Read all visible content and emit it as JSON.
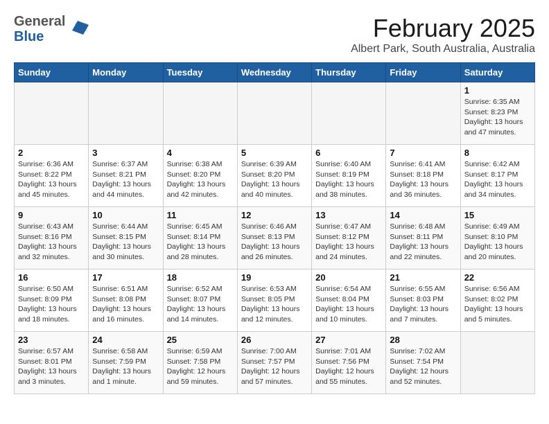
{
  "header": {
    "logo_general": "General",
    "logo_blue": "Blue",
    "month_title": "February 2025",
    "subtitle": "Albert Park, South Australia, Australia"
  },
  "days_of_week": [
    "Sunday",
    "Monday",
    "Tuesday",
    "Wednesday",
    "Thursday",
    "Friday",
    "Saturday"
  ],
  "weeks": [
    [
      {
        "day": "",
        "info": ""
      },
      {
        "day": "",
        "info": ""
      },
      {
        "day": "",
        "info": ""
      },
      {
        "day": "",
        "info": ""
      },
      {
        "day": "",
        "info": ""
      },
      {
        "day": "",
        "info": ""
      },
      {
        "day": "1",
        "info": "Sunrise: 6:35 AM\nSunset: 8:23 PM\nDaylight: 13 hours and 47 minutes."
      }
    ],
    [
      {
        "day": "2",
        "info": "Sunrise: 6:36 AM\nSunset: 8:22 PM\nDaylight: 13 hours and 45 minutes."
      },
      {
        "day": "3",
        "info": "Sunrise: 6:37 AM\nSunset: 8:21 PM\nDaylight: 13 hours and 44 minutes."
      },
      {
        "day": "4",
        "info": "Sunrise: 6:38 AM\nSunset: 8:20 PM\nDaylight: 13 hours and 42 minutes."
      },
      {
        "day": "5",
        "info": "Sunrise: 6:39 AM\nSunset: 8:20 PM\nDaylight: 13 hours and 40 minutes."
      },
      {
        "day": "6",
        "info": "Sunrise: 6:40 AM\nSunset: 8:19 PM\nDaylight: 13 hours and 38 minutes."
      },
      {
        "day": "7",
        "info": "Sunrise: 6:41 AM\nSunset: 8:18 PM\nDaylight: 13 hours and 36 minutes."
      },
      {
        "day": "8",
        "info": "Sunrise: 6:42 AM\nSunset: 8:17 PM\nDaylight: 13 hours and 34 minutes."
      }
    ],
    [
      {
        "day": "9",
        "info": "Sunrise: 6:43 AM\nSunset: 8:16 PM\nDaylight: 13 hours and 32 minutes."
      },
      {
        "day": "10",
        "info": "Sunrise: 6:44 AM\nSunset: 8:15 PM\nDaylight: 13 hours and 30 minutes."
      },
      {
        "day": "11",
        "info": "Sunrise: 6:45 AM\nSunset: 8:14 PM\nDaylight: 13 hours and 28 minutes."
      },
      {
        "day": "12",
        "info": "Sunrise: 6:46 AM\nSunset: 8:13 PM\nDaylight: 13 hours and 26 minutes."
      },
      {
        "day": "13",
        "info": "Sunrise: 6:47 AM\nSunset: 8:12 PM\nDaylight: 13 hours and 24 minutes."
      },
      {
        "day": "14",
        "info": "Sunrise: 6:48 AM\nSunset: 8:11 PM\nDaylight: 13 hours and 22 minutes."
      },
      {
        "day": "15",
        "info": "Sunrise: 6:49 AM\nSunset: 8:10 PM\nDaylight: 13 hours and 20 minutes."
      }
    ],
    [
      {
        "day": "16",
        "info": "Sunrise: 6:50 AM\nSunset: 8:09 PM\nDaylight: 13 hours and 18 minutes."
      },
      {
        "day": "17",
        "info": "Sunrise: 6:51 AM\nSunset: 8:08 PM\nDaylight: 13 hours and 16 minutes."
      },
      {
        "day": "18",
        "info": "Sunrise: 6:52 AM\nSunset: 8:07 PM\nDaylight: 13 hours and 14 minutes."
      },
      {
        "day": "19",
        "info": "Sunrise: 6:53 AM\nSunset: 8:05 PM\nDaylight: 13 hours and 12 minutes."
      },
      {
        "day": "20",
        "info": "Sunrise: 6:54 AM\nSunset: 8:04 PM\nDaylight: 13 hours and 10 minutes."
      },
      {
        "day": "21",
        "info": "Sunrise: 6:55 AM\nSunset: 8:03 PM\nDaylight: 13 hours and 7 minutes."
      },
      {
        "day": "22",
        "info": "Sunrise: 6:56 AM\nSunset: 8:02 PM\nDaylight: 13 hours and 5 minutes."
      }
    ],
    [
      {
        "day": "23",
        "info": "Sunrise: 6:57 AM\nSunset: 8:01 PM\nDaylight: 13 hours and 3 minutes."
      },
      {
        "day": "24",
        "info": "Sunrise: 6:58 AM\nSunset: 7:59 PM\nDaylight: 13 hours and 1 minute."
      },
      {
        "day": "25",
        "info": "Sunrise: 6:59 AM\nSunset: 7:58 PM\nDaylight: 12 hours and 59 minutes."
      },
      {
        "day": "26",
        "info": "Sunrise: 7:00 AM\nSunset: 7:57 PM\nDaylight: 12 hours and 57 minutes."
      },
      {
        "day": "27",
        "info": "Sunrise: 7:01 AM\nSunset: 7:56 PM\nDaylight: 12 hours and 55 minutes."
      },
      {
        "day": "28",
        "info": "Sunrise: 7:02 AM\nSunset: 7:54 PM\nDaylight: 12 hours and 52 minutes."
      },
      {
        "day": "",
        "info": ""
      }
    ]
  ]
}
